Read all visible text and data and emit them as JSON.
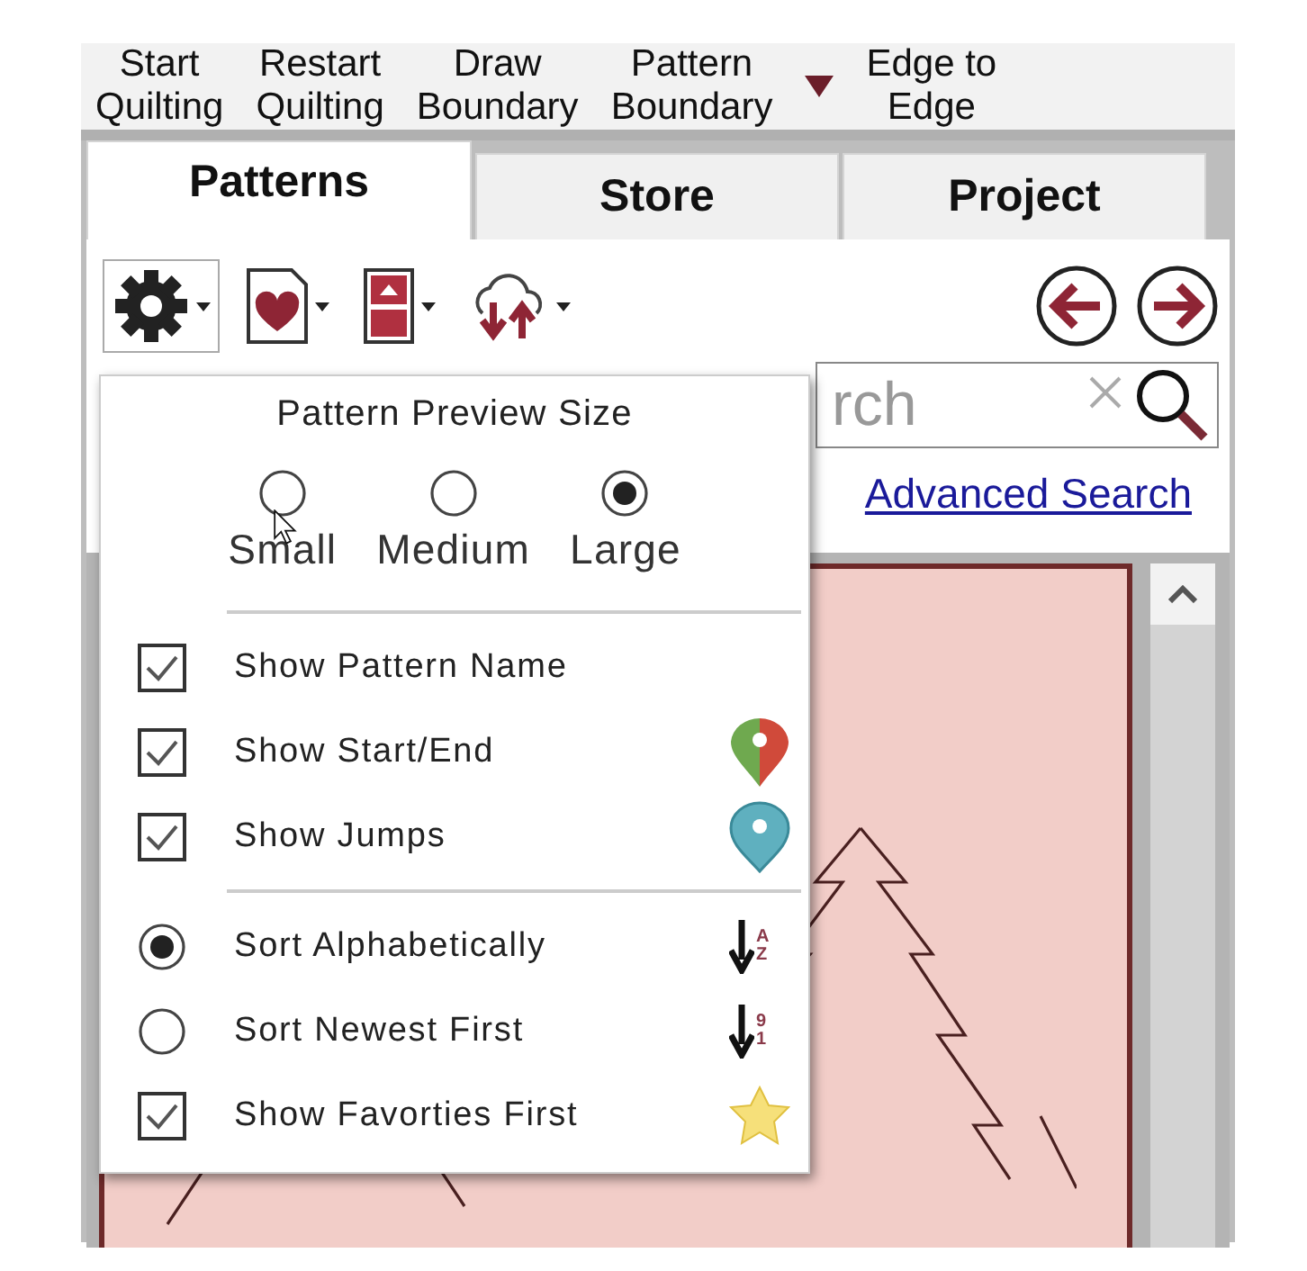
{
  "toolbar": [
    {
      "kind": "button",
      "lines": [
        "Start",
        "Quilting"
      ]
    },
    {
      "kind": "button",
      "lines": [
        "Restart",
        "Quilting"
      ]
    },
    {
      "kind": "button",
      "lines": [
        "Draw",
        "Boundary"
      ]
    },
    {
      "kind": "button",
      "lines": [
        "Pattern",
        "Boundary"
      ]
    },
    {
      "kind": "menu"
    },
    {
      "kind": "button",
      "lines": [
        "Edge to",
        "Edge"
      ]
    }
  ],
  "tabs": [
    {
      "label": "Patterns",
      "selected": true
    },
    {
      "label": "Store",
      "selected": false
    },
    {
      "label": "Project",
      "selected": false
    }
  ],
  "search": {
    "placeholder": "rch"
  },
  "advanced_link": "Advanced Search",
  "popup": {
    "title": "Pattern Preview Size",
    "sizes": [
      {
        "label": "Small",
        "selected": false
      },
      {
        "label": "Medium",
        "selected": false
      },
      {
        "label": "Large",
        "selected": true
      }
    ],
    "groups": [
      [
        {
          "kind": "checkbox",
          "label": "Show Pattern Name",
          "checked": true
        },
        {
          "kind": "checkbox",
          "label": "Show Start/End",
          "checked": true
        },
        {
          "kind": "checkbox",
          "label": "Show Jumps",
          "checked": true
        }
      ],
      [
        {
          "kind": "radio",
          "label": "Sort Alphabetically",
          "selected": true,
          "sort_keys": [
            "A",
            "Z"
          ]
        },
        {
          "kind": "radio",
          "label": "Sort Newest First",
          "selected": false,
          "sort_keys": [
            "9",
            "1"
          ]
        },
        {
          "kind": "checkbox",
          "label": "Show Favorties First",
          "checked": true
        }
      ]
    ]
  }
}
